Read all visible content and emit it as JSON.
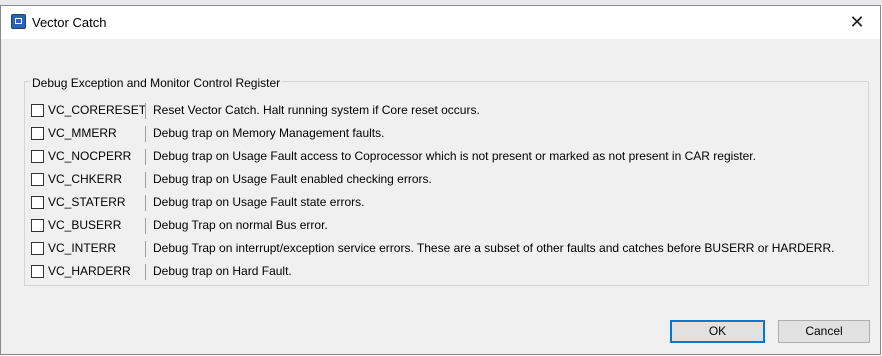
{
  "window": {
    "title": "Vector Catch",
    "close_glyph": "✕"
  },
  "group": {
    "legend": "Debug Exception and Monitor Control Register"
  },
  "rows": [
    {
      "name": "VC_CORERESET",
      "desc": "Reset Vector Catch. Halt running system if Core reset occurs.",
      "checked": false
    },
    {
      "name": "VC_MMERR",
      "desc": "Debug trap on Memory Management faults.",
      "checked": false
    },
    {
      "name": "VC_NOCPERR",
      "desc": "Debug trap on Usage Fault access to Coprocessor which is not present or marked as not present in CAR register.",
      "checked": false
    },
    {
      "name": "VC_CHKERR",
      "desc": "Debug trap on Usage Fault enabled checking errors.",
      "checked": false
    },
    {
      "name": "VC_STATERR",
      "desc": "Debug trap on Usage Fault state errors.",
      "checked": false
    },
    {
      "name": "VC_BUSERR",
      "desc": "Debug Trap on normal Bus error.",
      "checked": false
    },
    {
      "name": "VC_INTERR",
      "desc": "Debug Trap on interrupt/exception service errors. These are a subset of other faults and catches before BUSERR or HARDERR.",
      "checked": false
    },
    {
      "name": "VC_HARDERR",
      "desc": "Debug trap on Hard Fault.",
      "checked": false
    }
  ],
  "buttons": {
    "ok": "OK",
    "cancel": "Cancel"
  },
  "colors": {
    "accent": "#0078d7",
    "dialog_bg": "#f0f0f0"
  }
}
